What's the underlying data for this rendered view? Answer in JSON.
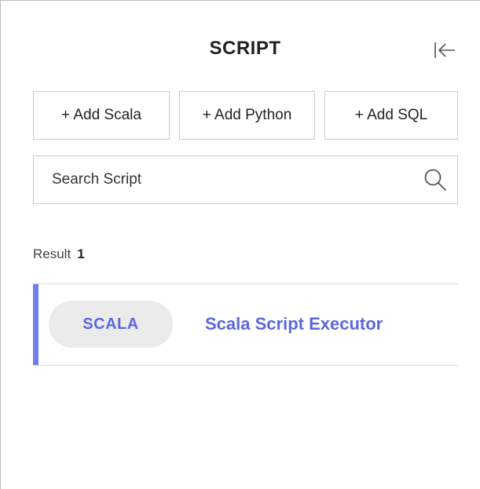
{
  "panel": {
    "title": "SCRIPT"
  },
  "toolbar": {
    "add_scala_label": "+ Add Scala",
    "add_python_label": "+ Add Python",
    "add_sql_label": "+ Add SQL"
  },
  "search": {
    "placeholder": "Search Script",
    "value": "",
    "icon": "search-icon"
  },
  "results": {
    "label": "Result",
    "count": "1",
    "items": [
      {
        "language": "SCALA",
        "name": "Scala Script Executor",
        "accent_color": "#6f7ff0"
      }
    ]
  },
  "colors": {
    "accent": "#6f7ff0",
    "accent_text": "#5a68e0",
    "badge_bg": "#ebebeb",
    "border": "#cccccc"
  },
  "icons": {
    "collapse": "collapse-left-icon",
    "search": "search-icon"
  }
}
